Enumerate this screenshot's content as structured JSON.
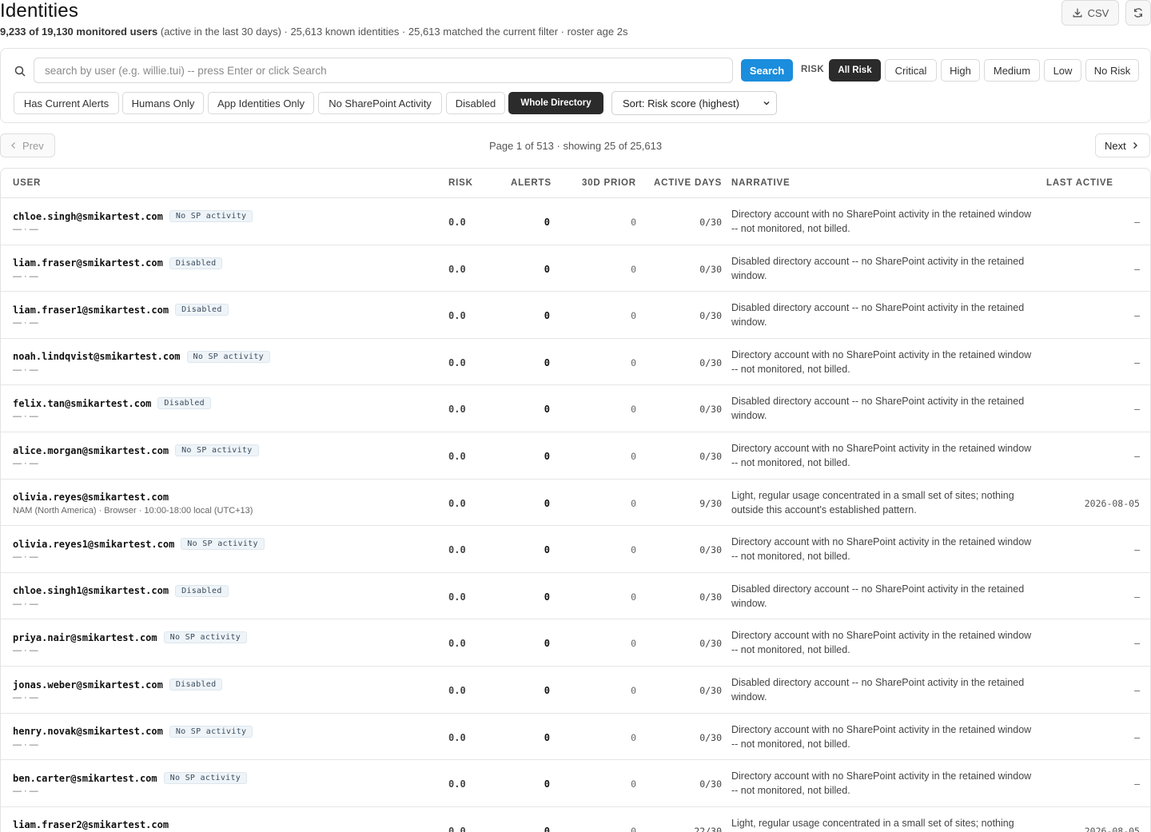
{
  "header": {
    "title": "Identities",
    "monitored": "9,233 of 19,130 monitored users",
    "summary": " (active in the last 30 days) · 25,613 known identities · 25,613 matched the current filter · roster age 2s",
    "csv_label": "CSV"
  },
  "search": {
    "placeholder": "search by user (e.g. willie.tui) -- press Enter or click Search",
    "button": "Search",
    "risk_label": "RISK"
  },
  "risk_filters": [
    "All Risk",
    "Critical",
    "High",
    "Medium",
    "Low",
    "No Risk"
  ],
  "active_risk": "All Risk",
  "scope_filters": [
    "Has Current Alerts",
    "Humans Only",
    "App Identities Only",
    "No SharePoint Activity",
    "Disabled",
    "Whole Directory"
  ],
  "active_scope": "Whole Directory",
  "sort": {
    "label": "Sort: Risk score (highest)"
  },
  "pagination": {
    "prev": "Prev",
    "next": "Next",
    "info": "Page 1 of 513 · showing 25 of 25,613"
  },
  "table": {
    "columns": [
      "USER",
      "RISK",
      "ALERTS",
      "30D PRIOR",
      "ACTIVE DAYS",
      "NARRATIVE",
      "LAST ACTIVE"
    ],
    "rows": [
      {
        "user": "chloe.singh@smikartest.com",
        "badge": "No SP activity",
        "meta": "— · —",
        "risk": "0.0",
        "alerts": "0",
        "prior": "0",
        "active": "0/30",
        "narrative": "Directory account with no SharePoint activity in the retained window -- not monitored, not billed.",
        "last": "—"
      },
      {
        "user": "liam.fraser@smikartest.com",
        "badge": "Disabled",
        "meta": "— · —",
        "risk": "0.0",
        "alerts": "0",
        "prior": "0",
        "active": "0/30",
        "narrative": "Disabled directory account -- no SharePoint activity in the retained window.",
        "last": "—"
      },
      {
        "user": "liam.fraser1@smikartest.com",
        "badge": "Disabled",
        "meta": "— · —",
        "risk": "0.0",
        "alerts": "0",
        "prior": "0",
        "active": "0/30",
        "narrative": "Disabled directory account -- no SharePoint activity in the retained window.",
        "last": "—"
      },
      {
        "user": "noah.lindqvist@smikartest.com",
        "badge": "No SP activity",
        "meta": "— · —",
        "risk": "0.0",
        "alerts": "0",
        "prior": "0",
        "active": "0/30",
        "narrative": "Directory account with no SharePoint activity in the retained window -- not monitored, not billed.",
        "last": "—"
      },
      {
        "user": "felix.tan@smikartest.com",
        "badge": "Disabled",
        "meta": "— · —",
        "risk": "0.0",
        "alerts": "0",
        "prior": "0",
        "active": "0/30",
        "narrative": "Disabled directory account -- no SharePoint activity in the retained window.",
        "last": "—"
      },
      {
        "user": "alice.morgan@smikartest.com",
        "badge": "No SP activity",
        "meta": "— · —",
        "risk": "0.0",
        "alerts": "0",
        "prior": "0",
        "active": "0/30",
        "narrative": "Directory account with no SharePoint activity in the retained window -- not monitored, not billed.",
        "last": "—"
      },
      {
        "user": "olivia.reyes@smikartest.com",
        "badge": "",
        "meta": "NAM (North America) · Browser · 10:00-18:00 local (UTC+13)",
        "risk": "0.0",
        "alerts": "0",
        "prior": "0",
        "active": "9/30",
        "narrative": "Light, regular usage concentrated in a small set of sites; nothing outside this account's established pattern.",
        "last": "2026-08-05"
      },
      {
        "user": "olivia.reyes1@smikartest.com",
        "badge": "No SP activity",
        "meta": "— · —",
        "risk": "0.0",
        "alerts": "0",
        "prior": "0",
        "active": "0/30",
        "narrative": "Directory account with no SharePoint activity in the retained window -- not monitored, not billed.",
        "last": "—"
      },
      {
        "user": "chloe.singh1@smikartest.com",
        "badge": "Disabled",
        "meta": "— · —",
        "risk": "0.0",
        "alerts": "0",
        "prior": "0",
        "active": "0/30",
        "narrative": "Disabled directory account -- no SharePoint activity in the retained window.",
        "last": "—"
      },
      {
        "user": "priya.nair@smikartest.com",
        "badge": "No SP activity",
        "meta": "— · —",
        "risk": "0.0",
        "alerts": "0",
        "prior": "0",
        "active": "0/30",
        "narrative": "Directory account with no SharePoint activity in the retained window -- not monitored, not billed.",
        "last": "—"
      },
      {
        "user": "jonas.weber@smikartest.com",
        "badge": "Disabled",
        "meta": "— · —",
        "risk": "0.0",
        "alerts": "0",
        "prior": "0",
        "active": "0/30",
        "narrative": "Disabled directory account -- no SharePoint activity in the retained window.",
        "last": "—"
      },
      {
        "user": "henry.novak@smikartest.com",
        "badge": "No SP activity",
        "meta": "— · —",
        "risk": "0.0",
        "alerts": "0",
        "prior": "0",
        "active": "0/30",
        "narrative": "Directory account with no SharePoint activity in the retained window -- not monitored, not billed.",
        "last": "—"
      },
      {
        "user": "ben.carter@smikartest.com",
        "badge": "No SP activity",
        "meta": "— · —",
        "risk": "0.0",
        "alerts": "0",
        "prior": "0",
        "active": "0/30",
        "narrative": "Directory account with no SharePoint activity in the retained window -- not monitored, not billed.",
        "last": "—"
      },
      {
        "user": "liam.fraser2@smikartest.com",
        "badge": "",
        "meta": "",
        "risk": "0.0",
        "alerts": "0",
        "prior": "0",
        "active": "22/30",
        "narrative": "Light, regular usage concentrated in a small set of sites; nothing",
        "last": "2026-08-05"
      }
    ]
  }
}
